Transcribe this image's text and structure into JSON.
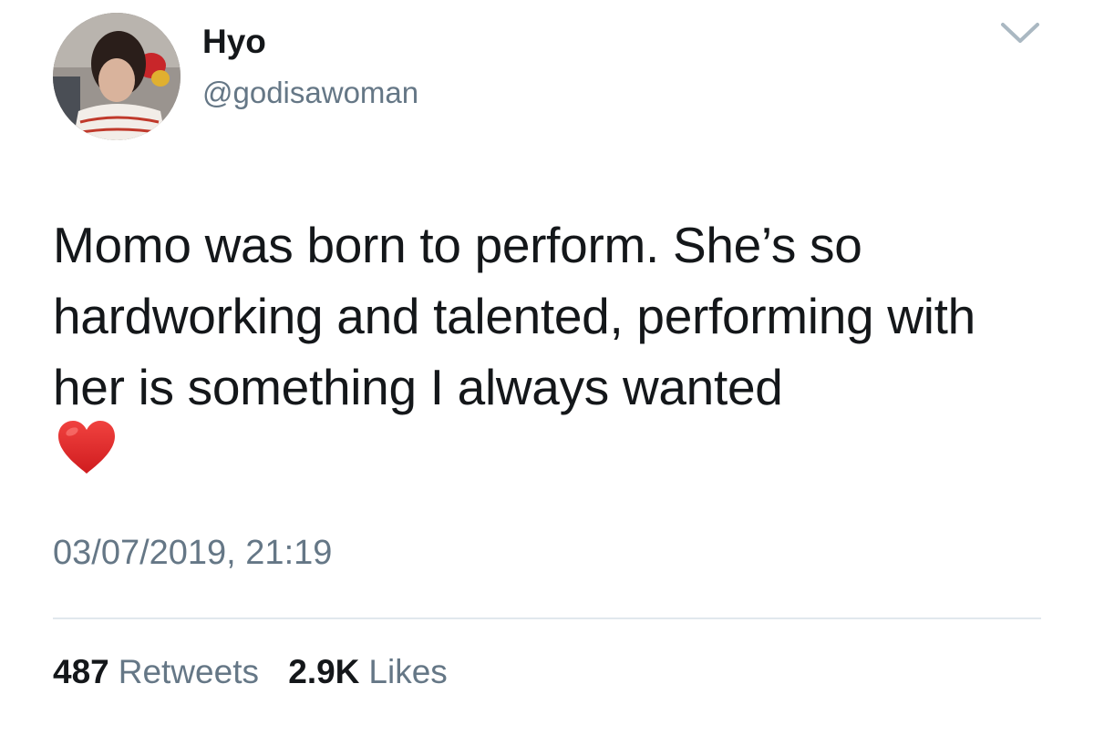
{
  "tweet": {
    "author": {
      "display_name": "Hyo",
      "handle": "@godisawoman"
    },
    "text": "Momo was born to perform. She’s so hardworking and talented, performing with her is something I always wanted",
    "emoji": "red-heart",
    "timestamp": "03/07/2019, 21:19",
    "retweets": {
      "count": "487",
      "label": "Retweets"
    },
    "likes": {
      "count": "2.9K",
      "label": "Likes"
    }
  },
  "icons": {
    "menu": "chevron-down-icon",
    "emoji": "heart-icon"
  },
  "colors": {
    "text_primary": "#14171a",
    "text_secondary": "#657786",
    "divider": "#e1e8ed",
    "heart": "#e0262a",
    "caret": "#aab8c2"
  }
}
